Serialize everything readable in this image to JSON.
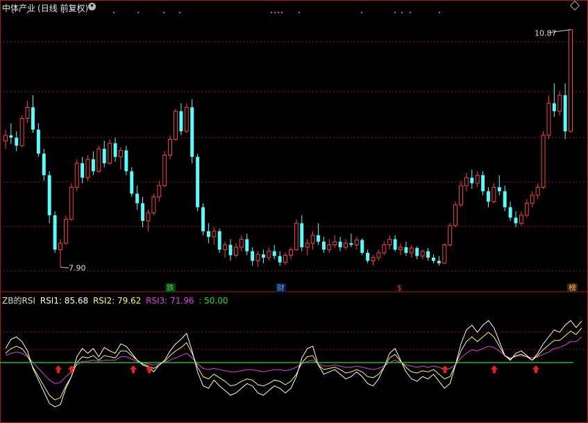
{
  "title": {
    "name": "中体产业",
    "period": "(日线 前复权)",
    "dropdown_icon": "chevron-down-icon"
  },
  "price_panel": {
    "high_label": "10.87",
    "low_label": "7.90",
    "colors": {
      "up": "#ff4040",
      "down": "#54ffff",
      "grid": "#8a1c1c",
      "border": "#b01818"
    }
  },
  "event_tags": [
    {
      "text": "跌",
      "color": "#3cd23c",
      "bg": "#0b3a0b"
    },
    {
      "text": "财",
      "color": "#5aa8ff",
      "bg": "#0b1e40"
    },
    {
      "text": "$",
      "color": "#ff3030",
      "bg": "#000000"
    },
    {
      "text": "榜",
      "color": "#ffb040",
      "bg": "#3a250a"
    }
  ],
  "indicator_panel": {
    "name": "ZB的RSI",
    "rsi1_label": "RSI1: 85.68",
    "rsi2_label": "RSI2: 79.62",
    "rsi3_label": "RSI3: 71.96",
    "level_label": ": 50.00",
    "colors": {
      "rsi1": "#ffffff",
      "rsi2": "#ffff50",
      "rsi3": "#e040e0",
      "level": "#22dd22",
      "arrow": "#ff1818"
    }
  },
  "chart_data": [
    {
      "type": "candlestick",
      "title": "中体产业 (日线 前复权)",
      "annotations": [
        "10.87",
        "7.90"
      ],
      "ohlc": [
        [
          9.48,
          9.62,
          9.38,
          9.55
        ],
        [
          9.55,
          9.7,
          9.44,
          9.52
        ],
        [
          9.52,
          9.6,
          9.35,
          9.42
        ],
        [
          9.42,
          9.8,
          9.4,
          9.76
        ],
        [
          9.76,
          9.98,
          9.7,
          9.9
        ],
        [
          9.9,
          10.05,
          9.58,
          9.62
        ],
        [
          9.62,
          9.7,
          9.28,
          9.32
        ],
        [
          9.32,
          9.38,
          8.98,
          9.05
        ],
        [
          9.05,
          9.1,
          8.45,
          8.55
        ],
        [
          8.55,
          8.6,
          8.08,
          8.12
        ],
        [
          8.12,
          8.25,
          7.9,
          8.2
        ],
        [
          8.2,
          8.55,
          8.18,
          8.5
        ],
        [
          8.5,
          8.95,
          8.48,
          8.9
        ],
        [
          8.9,
          9.25,
          8.85,
          9.2
        ],
        [
          9.2,
          9.28,
          8.95,
          9.02
        ],
        [
          9.02,
          9.3,
          8.98,
          9.25
        ],
        [
          9.25,
          9.35,
          9.05,
          9.1
        ],
        [
          9.1,
          9.42,
          9.08,
          9.38
        ],
        [
          9.38,
          9.48,
          9.15,
          9.2
        ],
        [
          9.2,
          9.5,
          9.18,
          9.45
        ],
        [
          9.45,
          9.52,
          9.22,
          9.28
        ],
        [
          9.28,
          9.4,
          9.12,
          9.36
        ],
        [
          9.36,
          9.42,
          9.05,
          9.1
        ],
        [
          9.1,
          9.15,
          8.78,
          8.82
        ],
        [
          8.82,
          8.92,
          8.62,
          8.7
        ],
        [
          8.7,
          8.78,
          8.4,
          8.48
        ],
        [
          8.48,
          8.62,
          8.35,
          8.58
        ],
        [
          8.58,
          8.82,
          8.55,
          8.78
        ],
        [
          8.78,
          8.98,
          8.72,
          8.92
        ],
        [
          8.92,
          9.35,
          8.9,
          9.3
        ],
        [
          9.3,
          9.55,
          9.25,
          9.5
        ],
        [
          9.5,
          9.88,
          9.48,
          9.85
        ],
        [
          9.85,
          9.95,
          9.55,
          9.6
        ],
        [
          9.6,
          9.95,
          9.58,
          9.9
        ],
        [
          9.9,
          10.0,
          9.2,
          9.28
        ],
        [
          9.28,
          9.32,
          8.6,
          8.65
        ],
        [
          8.65,
          8.7,
          8.3,
          8.35
        ],
        [
          8.35,
          8.45,
          8.2,
          8.28
        ],
        [
          8.28,
          8.4,
          8.18,
          8.35
        ],
        [
          8.35,
          8.38,
          8.08,
          8.12
        ],
        [
          8.12,
          8.22,
          8.02,
          8.18
        ],
        [
          8.18,
          8.25,
          7.98,
          8.05
        ],
        [
          8.05,
          8.2,
          8.02,
          8.15
        ],
        [
          8.15,
          8.3,
          8.1,
          8.25
        ],
        [
          8.25,
          8.32,
          8.05,
          8.1
        ],
        [
          8.1,
          8.15,
          7.92,
          7.98
        ],
        [
          7.98,
          8.1,
          7.9,
          8.06
        ],
        [
          8.06,
          8.12,
          7.95,
          8.02
        ],
        [
          8.02,
          8.15,
          7.98,
          8.1
        ],
        [
          8.1,
          8.18,
          8.0,
          8.04
        ],
        [
          8.04,
          8.1,
          7.92,
          7.96
        ],
        [
          7.96,
          8.08,
          7.93,
          8.05
        ],
        [
          8.05,
          8.15,
          8.0,
          8.12
        ],
        [
          8.12,
          8.5,
          8.1,
          8.45
        ],
        [
          8.45,
          8.55,
          8.1,
          8.15
        ],
        [
          8.15,
          8.25,
          8.05,
          8.2
        ],
        [
          8.2,
          8.35,
          8.12,
          8.3
        ],
        [
          8.3,
          8.45,
          8.18,
          8.22
        ],
        [
          8.22,
          8.28,
          8.08,
          8.12
        ],
        [
          8.12,
          8.25,
          8.08,
          8.18
        ],
        [
          8.18,
          8.3,
          8.14,
          8.22
        ],
        [
          8.22,
          8.28,
          8.1,
          8.15
        ],
        [
          8.15,
          8.25,
          8.12,
          8.2
        ],
        [
          8.2,
          8.32,
          8.15,
          8.18
        ],
        [
          8.18,
          8.28,
          8.12,
          8.24
        ],
        [
          8.24,
          8.26,
          8.05,
          8.08
        ],
        [
          8.08,
          8.12,
          7.95,
          7.98
        ],
        [
          7.98,
          8.05,
          7.92,
          8.02
        ],
        [
          8.02,
          8.12,
          7.98,
          8.08
        ],
        [
          8.08,
          8.22,
          8.05,
          8.18
        ],
        [
          8.18,
          8.3,
          8.12,
          8.25
        ],
        [
          8.25,
          8.3,
          8.1,
          8.12
        ],
        [
          8.12,
          8.2,
          8.05,
          8.15
        ],
        [
          8.15,
          8.22,
          8.04,
          8.08
        ],
        [
          8.08,
          8.18,
          8.02,
          8.14
        ],
        [
          8.14,
          8.16,
          8.0,
          8.04
        ],
        [
          8.04,
          8.12,
          8.0,
          8.1
        ],
        [
          8.1,
          8.14,
          7.98,
          8.02
        ],
        [
          8.02,
          8.06,
          7.95,
          7.98
        ],
        [
          7.98,
          8.04,
          7.92,
          7.95
        ],
        [
          7.95,
          8.2,
          7.94,
          8.18
        ],
        [
          8.18,
          8.45,
          8.16,
          8.42
        ],
        [
          8.42,
          8.72,
          8.4,
          8.68
        ],
        [
          8.68,
          8.98,
          8.65,
          8.92
        ],
        [
          8.92,
          9.08,
          8.85,
          9.02
        ],
        [
          9.02,
          9.12,
          8.88,
          8.95
        ],
        [
          8.95,
          9.1,
          8.9,
          9.05
        ],
        [
          9.05,
          9.1,
          8.8,
          8.85
        ],
        [
          8.85,
          8.9,
          8.65,
          8.72
        ],
        [
          8.72,
          8.95,
          8.7,
          8.9
        ],
        [
          8.9,
          9.05,
          8.8,
          8.85
        ],
        [
          8.85,
          8.92,
          8.6,
          8.65
        ],
        [
          8.65,
          8.72,
          8.48,
          8.52
        ],
        [
          8.52,
          8.6,
          8.4,
          8.45
        ],
        [
          8.45,
          8.6,
          8.42,
          8.55
        ],
        [
          8.55,
          8.75,
          8.52,
          8.7
        ],
        [
          8.7,
          8.85,
          8.65,
          8.8
        ],
        [
          8.8,
          8.95,
          8.75,
          8.9
        ],
        [
          8.9,
          9.6,
          8.88,
          9.55
        ],
        [
          9.55,
          10.05,
          9.5,
          9.95
        ],
        [
          9.95,
          10.2,
          9.78,
          9.85
        ],
        [
          9.85,
          10.1,
          9.8,
          10.05
        ],
        [
          10.05,
          10.2,
          9.5,
          9.6
        ],
        [
          9.6,
          10.87,
          9.58,
          10.87
        ]
      ],
      "ylim": [
        7.75,
        11.05
      ]
    },
    {
      "type": "line",
      "title": "ZB的RSI",
      "series": [
        {
          "name": "RSI1",
          "values": [
            62,
            70,
            72,
            68,
            60,
            45,
            35,
            25,
            15,
            12,
            14,
            28,
            38,
            55,
            62,
            58,
            62,
            55,
            63,
            60,
            58,
            66,
            64,
            58,
            52,
            48,
            46,
            42,
            48,
            52,
            60,
            66,
            70,
            75,
            60,
            42,
            30,
            28,
            35,
            30,
            26,
            22,
            24,
            28,
            32,
            30,
            24,
            22,
            26,
            30,
            28,
            24,
            28,
            38,
            54,
            62,
            64,
            48,
            40,
            42,
            44,
            40,
            36,
            38,
            42,
            38,
            32,
            30,
            36,
            46,
            58,
            62,
            52,
            42,
            36,
            34,
            38,
            36,
            40,
            34,
            28,
            32,
            48,
            66,
            78,
            82,
            76,
            82,
            86,
            80,
            68,
            56,
            52,
            58,
            60,
            56,
            52,
            58,
            66,
            72,
            78,
            76,
            82,
            86,
            80,
            85.68
          ]
        },
        {
          "name": "RSI2",
          "values": [
            58,
            62,
            64,
            62,
            56,
            46,
            38,
            30,
            22,
            18,
            20,
            30,
            38,
            50,
            55,
            54,
            56,
            52,
            56,
            55,
            54,
            60,
            60,
            56,
            52,
            49,
            47,
            45,
            48,
            51,
            56,
            60,
            63,
            67,
            58,
            46,
            38,
            36,
            40,
            37,
            34,
            30,
            31,
            34,
            36,
            35,
            31,
            30,
            32,
            35,
            34,
            31,
            34,
            40,
            50,
            55,
            56,
            48,
            44,
            45,
            46,
            44,
            41,
            42,
            44,
            42,
            38,
            37,
            40,
            46,
            54,
            57,
            51,
            46,
            42,
            41,
            43,
            42,
            44,
            40,
            36,
            38,
            48,
            60,
            68,
            72,
            68,
            72,
            76,
            72,
            64,
            56,
            53,
            56,
            57,
            55,
            52,
            56,
            61,
            65,
            69,
            69,
            73,
            77,
            74,
            79.62
          ]
        },
        {
          "name": "RSI3",
          "values": [
            56,
            58,
            59,
            58,
            55,
            50,
            45,
            40,
            35,
            32,
            33,
            38,
            42,
            48,
            51,
            51,
            52,
            51,
            52,
            52,
            52,
            55,
            55,
            53,
            51,
            50,
            49,
            48,
            49,
            50,
            52,
            54,
            56,
            58,
            54,
            49,
            45,
            44,
            45,
            44,
            43,
            42,
            42,
            43,
            44,
            44,
            43,
            42,
            43,
            44,
            44,
            43,
            44,
            46,
            49,
            51,
            52,
            49,
            47,
            47,
            48,
            47,
            46,
            46,
            47,
            46,
            45,
            44,
            45,
            47,
            50,
            52,
            50,
            48,
            47,
            46,
            47,
            46,
            47,
            46,
            44,
            45,
            48,
            54,
            58,
            61,
            60,
            62,
            64,
            63,
            60,
            56,
            54,
            55,
            56,
            55,
            54,
            55,
            57,
            59,
            62,
            63,
            65,
            68,
            68,
            71.96
          ]
        },
        {
          "name": "50.00",
          "values": [
            50
          ]
        }
      ],
      "signals": [
        "buy",
        "buy",
        "buy",
        "buy",
        "buy",
        "buy",
        "buy"
      ],
      "ylim": [
        0,
        100
      ]
    }
  ]
}
